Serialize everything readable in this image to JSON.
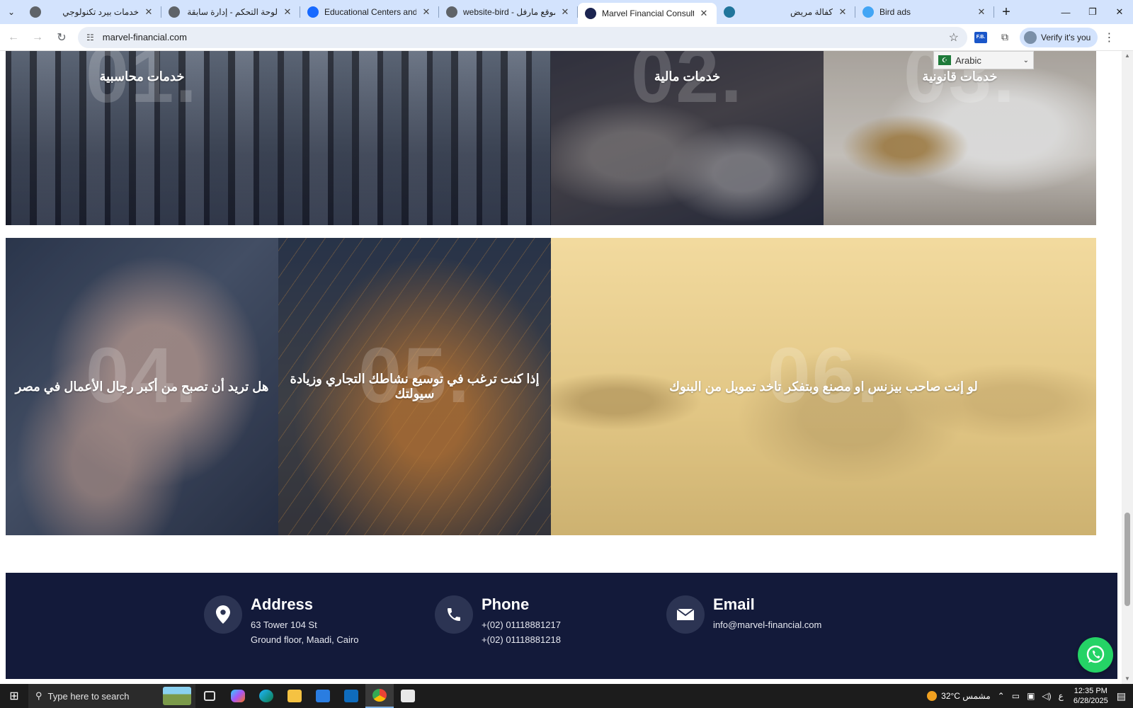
{
  "browser": {
    "tabs": [
      {
        "title": "خدمات بيرد تكنولوجي",
        "rtl": true,
        "fav": "globe-icon",
        "fav_color": "#5f6368"
      },
      {
        "title": "لوحة التحكم - إدارة سابقة الأعمال",
        "rtl": true,
        "fav": "globe-icon",
        "fav_color": "#5f6368"
      },
      {
        "title": "Educational Centers and Courses",
        "rtl": false,
        "fav": "behance-icon",
        "fav_color": "#1769ff"
      },
      {
        "title": "website-bird - موقع مارفل",
        "rtl": false,
        "fav": "globe-icon",
        "fav_color": "#5f6368"
      },
      {
        "title": "Marvel Financial Consultancy",
        "rtl": false,
        "fav": "marvel-icon",
        "fav_color": "#1b2450",
        "active": true
      },
      {
        "title": "كفالة مريض",
        "rtl": true,
        "fav": "wordpress-icon",
        "fav_color": "#21759b"
      },
      {
        "title": "Bird ads",
        "rtl": false,
        "fav": "flutter-icon",
        "fav_color": "#42a5f5"
      }
    ],
    "url": "marvel-financial.com",
    "verify_label": "Verify it's you",
    "extension_label": "F.B."
  },
  "language_widget": {
    "selected": "Arabic"
  },
  "services_row1": [
    {
      "num": "01.",
      "title": "خدمات محاسبية"
    },
    {
      "num": "02.",
      "title": "خدمات مالية"
    },
    {
      "num": "03.",
      "title": "خدمات قانونية"
    }
  ],
  "services_row2": [
    {
      "num": "04.",
      "title": "هل تريد أن تصبح من أكبر رجال الأعمال في مصر"
    },
    {
      "num": "05.",
      "title": "إذا كنت ترغب في توسيع نشاطك التجاري وزيادة سيولتك"
    },
    {
      "num": "06.",
      "title": "لو إنت صاحب بيزنس او مصنع وبتفكر تاخد تمويل من البنوك"
    }
  ],
  "contact": {
    "address": {
      "heading": "Address",
      "line1": "63 Tower 104 St",
      "line2": "Ground floor, Maadi, Cairo"
    },
    "phone": {
      "heading": "Phone",
      "line1": "+(02) 01118881217",
      "line2": "+(02) 01118881218"
    },
    "email": {
      "heading": "Email",
      "line1": "info@marvel-financial.com"
    }
  },
  "taskbar": {
    "search_placeholder": "Type here to search",
    "weather": "32°C مشمس",
    "lang": "ع",
    "time": "12:35 PM",
    "date": "6/28/2025"
  }
}
